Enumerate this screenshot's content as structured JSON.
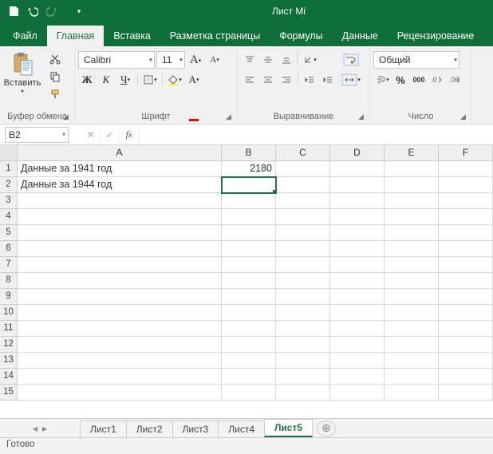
{
  "title": "Лист Mi",
  "tabs": {
    "file": "Файл",
    "home": "Главная",
    "insert": "Вставка",
    "layout": "Разметка страницы",
    "formulas": "Формулы",
    "data": "Данные",
    "review": "Рецензирование"
  },
  "ribbon": {
    "clipboard": {
      "paste": "Вставить",
      "label": "Буфер обмена"
    },
    "font": {
      "name": "Calibri",
      "size": "11",
      "label": "Шрифт",
      "bold": "Ж",
      "italic": "К",
      "underline": "Ч",
      "grow": "A",
      "shrink": "A"
    },
    "align": {
      "label": "Выравнивание"
    },
    "number": {
      "format": "Общий",
      "label": "Число",
      "pct": "%",
      "thou": "000"
    }
  },
  "namebox": "B2",
  "formula": "",
  "columns": [
    "A",
    "B",
    "C",
    "D",
    "E",
    "F"
  ],
  "rows": [
    1,
    2,
    3,
    4,
    5,
    6,
    7,
    8,
    9,
    10,
    11,
    12,
    13,
    14,
    15
  ],
  "cells": {
    "A1": "Данные за 1941 год",
    "B1": "2180",
    "A2": "Данные за 1944 год"
  },
  "activeCell": "B2",
  "sheets": [
    "Лист1",
    "Лист2",
    "Лист3",
    "Лист4",
    "Лист5"
  ],
  "activeSheet": "Лист5",
  "status": "Готово"
}
